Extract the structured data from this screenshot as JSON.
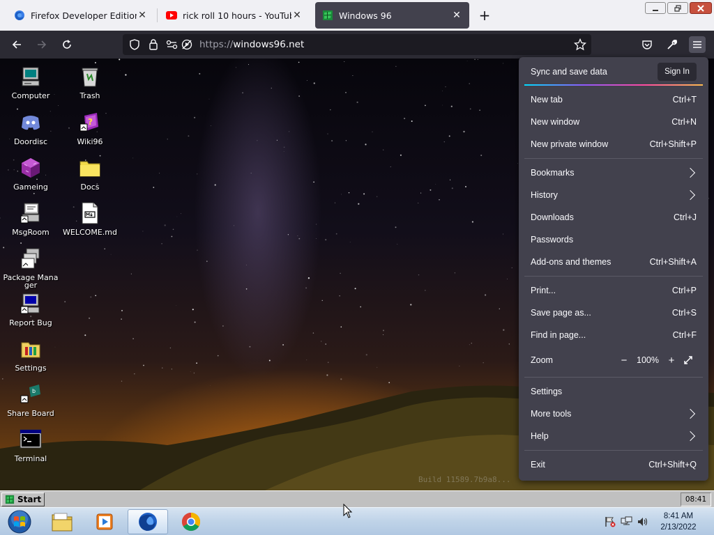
{
  "browser": {
    "tabs": [
      {
        "title": "Firefox Developer Edition",
        "favicon": "firefox-icon"
      },
      {
        "title": "rick roll 10 hours - YouTube",
        "favicon": "youtube-icon"
      },
      {
        "title": "Windows 96",
        "favicon": "windows96-icon"
      }
    ],
    "new_tab_label": "+",
    "close_glyph": "✕",
    "url_scheme": "https://",
    "url_host": "windows96.net"
  },
  "desktop": {
    "icons": [
      {
        "label": "Computer",
        "icon": "computer-icon"
      },
      {
        "label": "Trash",
        "icon": "trash-icon"
      },
      {
        "label": "Doordisc",
        "icon": "discord-icon"
      },
      {
        "label": "Wiki96",
        "icon": "wiki-icon"
      },
      {
        "label": "Gameing",
        "icon": "cube-icon"
      },
      {
        "label": "Docs",
        "icon": "folder-icon"
      },
      {
        "label": "MsgRoom",
        "icon": "msgroom-icon"
      },
      {
        "label": "WELCOME.md",
        "icon": "document-icon"
      },
      {
        "label": "Package Manager",
        "icon": "package-icon"
      },
      {
        "label": "Report Bug",
        "icon": "bug-report-icon"
      },
      {
        "label": "Settings",
        "icon": "settings-folder-icon"
      },
      {
        "label": "Share Board",
        "icon": "share-board-icon"
      },
      {
        "label": "Terminal",
        "icon": "terminal-icon"
      }
    ],
    "build_text": "Build 11589.7b9a8..."
  },
  "win96_taskbar": {
    "start_label": "Start",
    "clock": "08:41"
  },
  "win7_taskbar": {
    "time": "8:41 AM",
    "date": "2/13/2022"
  },
  "app_menu": {
    "sync_label": "Sync and save data",
    "sign_in_label": "Sign In",
    "items": [
      {
        "label": "New tab",
        "shortcut": "Ctrl+T"
      },
      {
        "label": "New window",
        "shortcut": "Ctrl+N"
      },
      {
        "label": "New private window",
        "shortcut": "Ctrl+Shift+P"
      },
      {
        "label": "Bookmarks",
        "shortcut": ""
      },
      {
        "label": "History",
        "shortcut": ""
      },
      {
        "label": "Downloads",
        "shortcut": "Ctrl+J"
      },
      {
        "label": "Passwords",
        "shortcut": ""
      },
      {
        "label": "Add-ons and themes",
        "shortcut": "Ctrl+Shift+A"
      },
      {
        "label": "Print...",
        "shortcut": "Ctrl+P"
      },
      {
        "label": "Save page as...",
        "shortcut": "Ctrl+S"
      },
      {
        "label": "Find in page...",
        "shortcut": "Ctrl+F"
      },
      {
        "label": "Settings",
        "shortcut": ""
      },
      {
        "label": "More tools",
        "shortcut": ""
      },
      {
        "label": "Help",
        "shortcut": ""
      },
      {
        "label": "Exit",
        "shortcut": "Ctrl+Shift+Q"
      }
    ],
    "zoom": {
      "label": "Zoom",
      "minus": "−",
      "value": "100%",
      "plus": "+"
    }
  },
  "colors": {
    "menu_bg": "#42414d",
    "toolbar_bg": "#2b2a33",
    "tabstrip_bg": "#f0f0f4",
    "win96_gray": "#c0c0c0"
  }
}
